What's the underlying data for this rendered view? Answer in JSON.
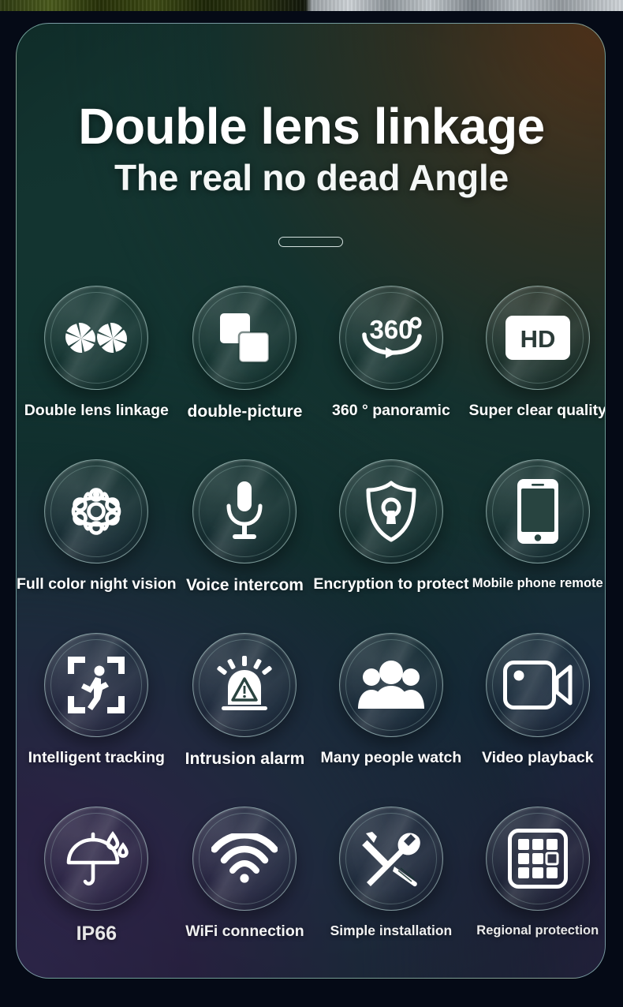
{
  "header": {
    "title_main": "Double lens linkage",
    "title_sub": "The real no dead Angle"
  },
  "features": [
    {
      "icon": "dual-aperture-icon",
      "label": "Double lens linkage"
    },
    {
      "icon": "picture-in-picture-icon",
      "label": "double-picture"
    },
    {
      "icon": "360-panoramic-icon",
      "label": "360 ° panoramic",
      "badge_text": "360"
    },
    {
      "icon": "hd-badge-icon",
      "label": "Super clear quality",
      "badge_text": "HD"
    },
    {
      "icon": "night-vision-icon",
      "label": "Full color night vision"
    },
    {
      "icon": "microphone-icon",
      "label": "Voice intercom"
    },
    {
      "icon": "shield-lock-icon",
      "label": "Encryption to protect"
    },
    {
      "icon": "mobile-phone-icon",
      "label": "Mobile phone remote"
    },
    {
      "icon": "motion-tracking-icon",
      "label": "Intelligent tracking"
    },
    {
      "icon": "siren-alarm-icon",
      "label": "Intrusion alarm"
    },
    {
      "icon": "people-group-icon",
      "label": "Many people watch"
    },
    {
      "icon": "video-camera-icon",
      "label": "Video playback"
    },
    {
      "icon": "umbrella-rain-icon",
      "label": "IP66"
    },
    {
      "icon": "wifi-icon",
      "label": "WiFi connection"
    },
    {
      "icon": "tools-icon",
      "label": "Simple installation"
    },
    {
      "icon": "grid-zones-icon",
      "label": "Regional protection"
    }
  ],
  "colors": {
    "card_border": "#a8ded6",
    "icon_white": "#ffffff",
    "text_white": "#ffffff",
    "bg_green": "#133430",
    "bg_brown": "#56341a",
    "bg_purple": "#2a2344"
  }
}
